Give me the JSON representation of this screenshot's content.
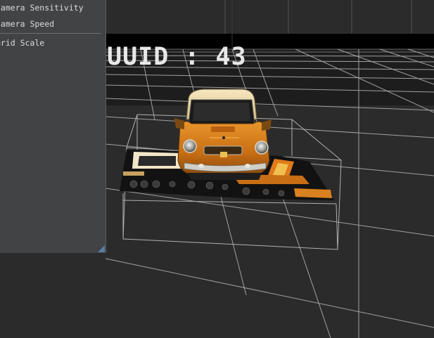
{
  "overlay": {
    "uuid_text": "UUID : 43"
  },
  "settings_panel": {
    "items": [
      {
        "label": "Camera Sensitivity"
      },
      {
        "label": "Camera Speed"
      },
      {
        "label": "Grid Scale"
      }
    ]
  },
  "scene": {
    "object": "taxi-car-model",
    "colors": {
      "background": "#2b2b2b",
      "sky_band": "#000000",
      "grid_line": "#9a9a9a",
      "car_body": "#d9801c",
      "car_roof": "#f0ddb0"
    }
  }
}
